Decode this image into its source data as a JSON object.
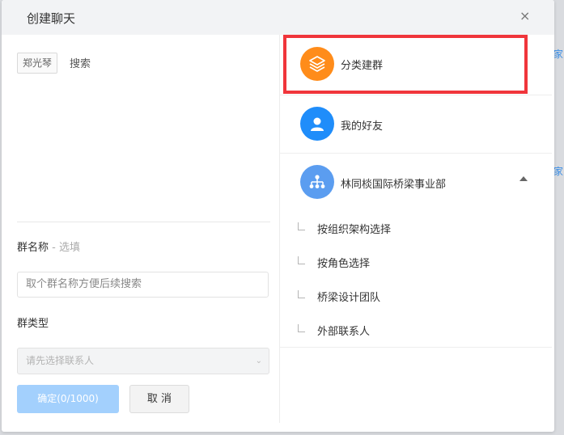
{
  "background": {
    "links": [
      "家",
      "家"
    ]
  },
  "dialog": {
    "title": "创建聊天",
    "close_symbol": "×"
  },
  "left": {
    "selected_tag": "郑光琴",
    "search_label": "搜索",
    "group_name_label": "群名称",
    "group_name_optional": " - 选填",
    "group_name_placeholder": "取个群名称方便后续搜索",
    "group_type_label": "群类型",
    "group_type_placeholder": "请先选择联系人",
    "confirm_label": "确定(0/1000)",
    "cancel_label": "取 消"
  },
  "right": {
    "items": [
      {
        "label": "分类建群",
        "icon": "layers-icon",
        "color": "#ff8c1a"
      },
      {
        "label": "我的好友",
        "icon": "person-icon",
        "color": "#1f8dfa"
      },
      {
        "label": "林同棪国际桥梁事业部",
        "icon": "org-chart-icon",
        "color": "#5b9df0",
        "expanded": true
      }
    ],
    "subitems": [
      "按组织架构选择",
      "按角色选择",
      "桥梁设计团队",
      "外部联系人"
    ]
  },
  "accent_colors": {
    "highlight_border": "#f0353b",
    "primary_button": "#a3d0fd"
  }
}
